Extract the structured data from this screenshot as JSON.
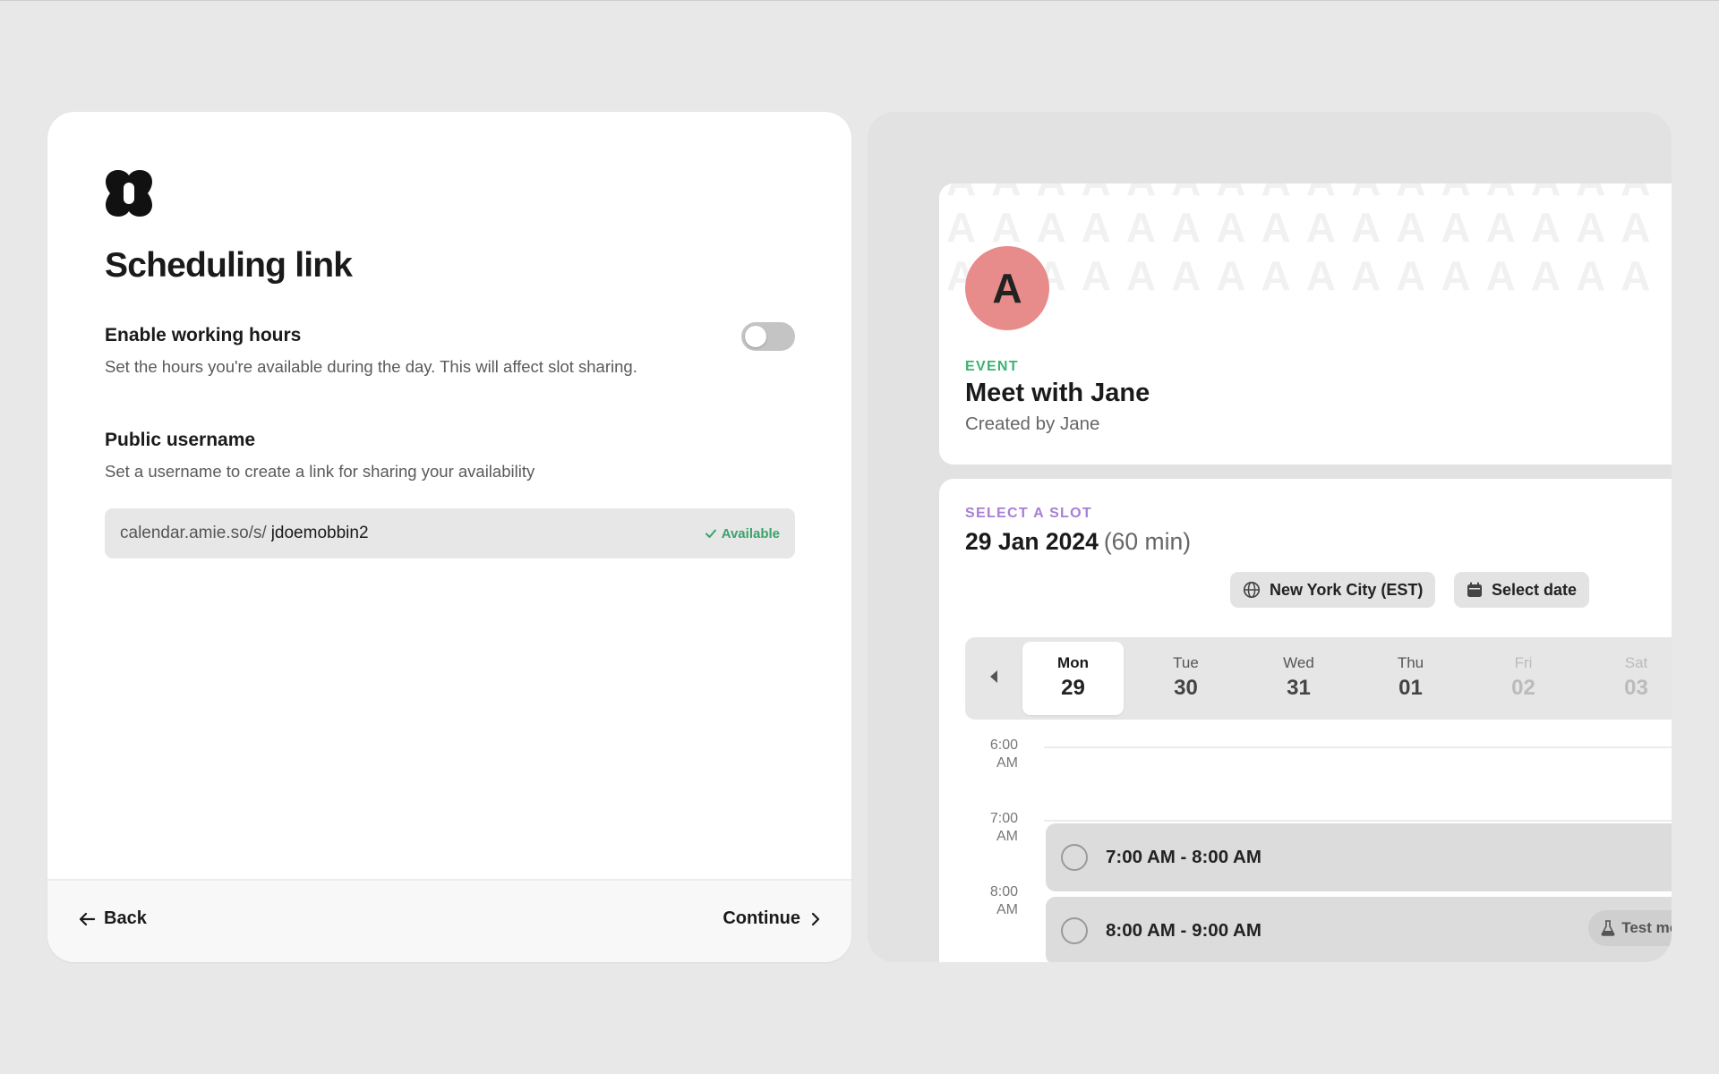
{
  "setup": {
    "title": "Scheduling link",
    "working_hours": {
      "title": "Enable working hours",
      "description": "Set the hours you're available during the day. This will affect slot sharing.",
      "enabled": false
    },
    "username": {
      "title": "Public username",
      "description": "Set a username to create a link for sharing your availability",
      "prefix": "calendar.amie.so/s/",
      "value": "jdoemobbin2",
      "status": "Available"
    },
    "footer": {
      "back_label": "Back",
      "continue_label": "Continue"
    }
  },
  "preview": {
    "pattern_letter": "A",
    "avatar_initial": "A",
    "event": {
      "eyebrow": "EVENT",
      "title": "Meet with Jane",
      "creator": "Created by Jane"
    },
    "slot_picker": {
      "eyebrow": "SELECT A SLOT",
      "date": "29 Jan 2024",
      "duration": "(60 min)",
      "timezone_label": "New York City (EST)",
      "select_date_label": "Select date",
      "days": [
        {
          "name": "Mon",
          "num": "29"
        },
        {
          "name": "Tue",
          "num": "30"
        },
        {
          "name": "Wed",
          "num": "31"
        },
        {
          "name": "Thu",
          "num": "01"
        },
        {
          "name": "Fri",
          "num": "02"
        },
        {
          "name": "Sat",
          "num": "03"
        }
      ],
      "times": [
        {
          "hour": "6:00",
          "ampm": "AM"
        },
        {
          "hour": "7:00",
          "ampm": "AM"
        },
        {
          "hour": "8:00",
          "ampm": "AM"
        }
      ],
      "slots": [
        "7:00 AM - 8:00 AM",
        "8:00 AM - 9:00 AM"
      ],
      "test_mode_label": "Test mode"
    }
  },
  "colors": {
    "event_accent": "#3cb371",
    "slot_accent": "#a77fd4",
    "available_green": "#3aa36a",
    "avatar_bg": "#e88b8b"
  }
}
